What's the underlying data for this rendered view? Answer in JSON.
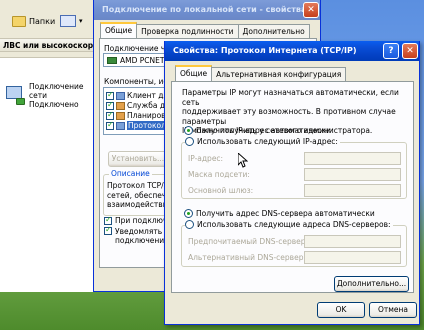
{
  "explorer": {
    "folders_label": "Папки",
    "header": "ЛВС или высокоскоро",
    "lan_item": {
      "line1": "Подключение",
      "line2": "сети",
      "line3": "Подключено"
    }
  },
  "lan_window": {
    "title": "Подключение по локальной сети - свойства",
    "tabs": [
      "Общие",
      "Проверка подлинности",
      "Дополнительно"
    ],
    "connect_using_label": "Подключение через",
    "adapter": "AMD PCNET",
    "components_label": "Компоненты, испо",
    "components": [
      {
        "label": "Клиент для",
        "checked": true
      },
      {
        "label": "Служба до",
        "checked": true
      },
      {
        "label": "Планиров",
        "checked": true
      },
      {
        "label": "Протокол",
        "checked": true
      }
    ],
    "install_button": "Установить...",
    "description_title": "Описание",
    "description_lines": [
      "Протокол TCP/IP",
      "сетей, обеспече",
      "взаимодействие"
    ],
    "notify_option1": "При подключ",
    "notify_option2_line1": "Уведомлять",
    "notify_option2_line2": "подключении"
  },
  "tcp_window": {
    "title": "Свойства: Протокол Интернета (TCP/IP)",
    "tabs": [
      "Общие",
      "Альтернативная конфигурация"
    ],
    "intro_lines": [
      "Параметры IP могут назначаться автоматически, если сеть",
      "поддерживает эту возможность. В противном случае параметры",
      "IP можно получить у сетевого администратора."
    ],
    "ip_auto": "Получить IP-адрес автоматически",
    "ip_manual": "Использовать следующий IP-адрес:",
    "ip_fields": [
      "IP-адрес:",
      "Маска подсети:",
      "Основной шлюз:"
    ],
    "dns_auto": "Получить адрес DNS-сервера автоматически",
    "dns_manual": "Использовать следующие адреса DNS-серверов:",
    "dns_fields": [
      "Предпочитаемый DNS-сервер:",
      "Альтернативный DNS-сервер:"
    ],
    "advanced_button": "Дополнительно...",
    "ok_button": "OK",
    "cancel_button": "Отмена"
  }
}
